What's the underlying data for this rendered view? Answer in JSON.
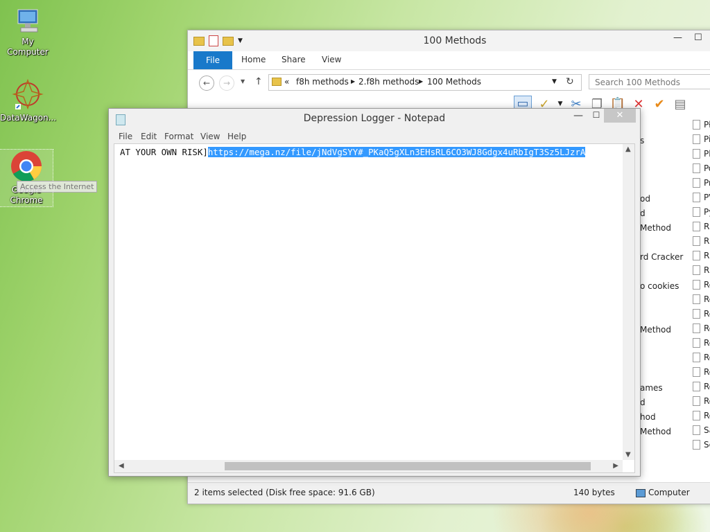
{
  "desktop": {
    "icons": [
      {
        "label": "My Computer"
      },
      {
        "label": "DataWagon..."
      },
      {
        "label": "Google Chrome"
      }
    ],
    "tooltip": "Access the Internet"
  },
  "explorer": {
    "title": "100 Methods",
    "tabs": [
      "File",
      "Home",
      "Share",
      "View"
    ],
    "breadcrumb": [
      "«",
      "f8h methods",
      "2.f8h methods",
      "100 Methods"
    ],
    "search_placeholder": "Search 100 Methods",
    "partial_names": [
      "s",
      "od",
      "d",
      "Method",
      "rd Cracker",
      "o cookies",
      "Method",
      "ames",
      "d",
      "hod",
      "Method"
    ],
    "file_prefixes": [
      "Pł",
      "Pi",
      "Pl",
      "Po",
      "Pr",
      "PV",
      "Py",
      "Ra",
      "RE",
      "RE",
      "RE",
      "Re",
      "Re",
      "Re",
      "Re",
      "Re",
      "Ro",
      "Ro",
      "Ro",
      "Ro",
      "Ro",
      "Sa",
      "Sc"
    ],
    "status": {
      "selected": "2 items selected (Disk free space: 91.6 GB)",
      "size": "140 bytes",
      "location": "Computer"
    }
  },
  "notepad": {
    "title": "Depression Logger - Notepad",
    "menu": [
      "File",
      "Edit",
      "Format",
      "View",
      "Help"
    ],
    "text_plain": "AT YOUR OWN RISK]",
    "text_selected": "https://mega.nz/file/jNdVgSYY#_PKaQ5gXLn3EHsRL6CO3WJ8Gdgx4uRbIgT3Sz5LJzrA"
  }
}
